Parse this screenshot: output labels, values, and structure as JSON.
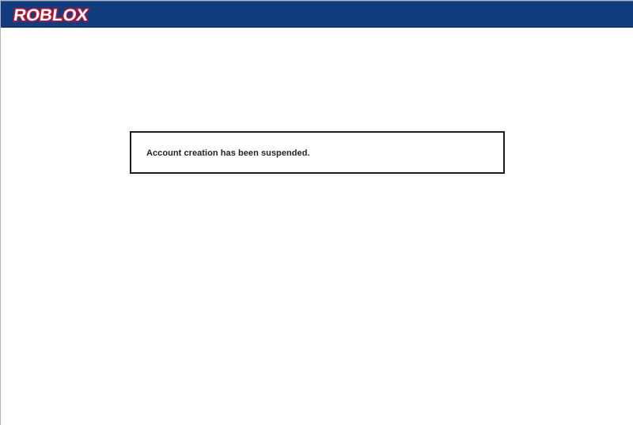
{
  "header": {
    "logo_text": "ROBLOX",
    "logo_icon": "roblox-logo-icon",
    "background_color": "#113d80",
    "logo_fill_color": "#ffffff",
    "logo_outline_color": "#c8102e"
  },
  "main": {
    "message": "Account creation has been suspended."
  }
}
